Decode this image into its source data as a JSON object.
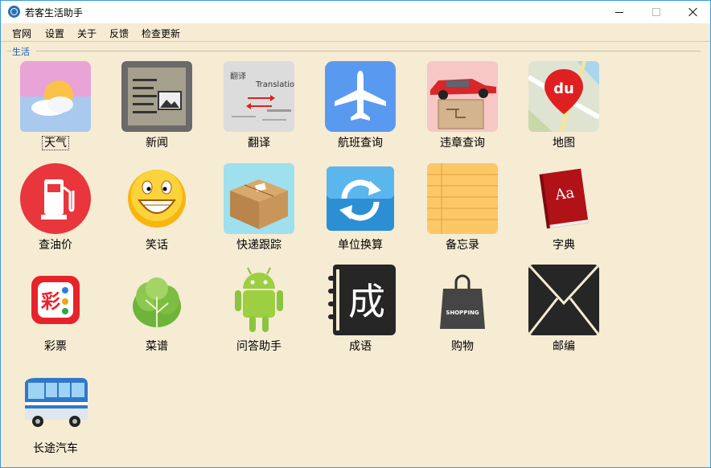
{
  "window": {
    "title": "若客生活助手"
  },
  "menu": {
    "items": [
      "官网",
      "设置",
      "关于",
      "反馈",
      "检查更新"
    ]
  },
  "group": {
    "label": "生活"
  },
  "tiles": [
    {
      "label": "天气",
      "icon": "weather-icon"
    },
    {
      "label": "新闻",
      "icon": "news-icon"
    },
    {
      "label": "翻译",
      "icon": "translate-icon"
    },
    {
      "label": "航班查询",
      "icon": "airplane-icon"
    },
    {
      "label": "违章查询",
      "icon": "car-violation-icon"
    },
    {
      "label": "地图",
      "icon": "map-icon"
    },
    {
      "label": "查油价",
      "icon": "fuel-pump-icon"
    },
    {
      "label": "笑话",
      "icon": "smiley-icon"
    },
    {
      "label": "快递跟踪",
      "icon": "package-icon"
    },
    {
      "label": "单位换算",
      "icon": "refresh-icon"
    },
    {
      "label": "备忘录",
      "icon": "notepad-icon"
    },
    {
      "label": "字典",
      "icon": "dictionary-icon"
    },
    {
      "label": "彩票",
      "icon": "lottery-icon"
    },
    {
      "label": "菜谱",
      "icon": "vegetable-icon"
    },
    {
      "label": "问答助手",
      "icon": "android-icon"
    },
    {
      "label": "成语",
      "icon": "idiom-icon"
    },
    {
      "label": "购物",
      "icon": "shopping-bag-icon"
    },
    {
      "label": "邮编",
      "icon": "envelope-icon"
    },
    {
      "label": "长途汽车",
      "icon": "bus-icon"
    }
  ],
  "icon_text": {
    "map_logo": "du",
    "dictionary_logo": "Aa",
    "idiom_char": "成",
    "lottery_char": "彩",
    "shopping_text": "SHOPPING",
    "translate_cn": "翻译",
    "translate_en": "Translation"
  },
  "colors": {
    "background": "#f6ebd3",
    "group_label": "#1a56b0",
    "window_border": "#3f9bd8"
  }
}
